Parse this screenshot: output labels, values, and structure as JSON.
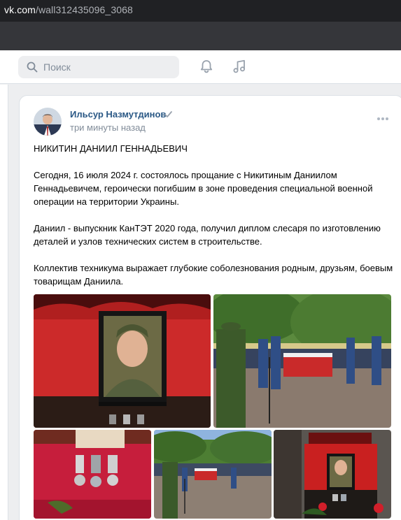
{
  "browser": {
    "url_host": "vk.com",
    "url_path": "/wall312435096_3068"
  },
  "header": {
    "search_placeholder": "Поиск",
    "icons": [
      "search-icon",
      "bell-icon",
      "music-icon"
    ]
  },
  "post": {
    "author": "Ильсур Назмутдинов",
    "time": "три минуты назад",
    "paragraphs": [
      "НИКИТИН ДАНИИЛ ГЕННАДЬЕВИЧ",
      "Сегодня, 16 июля 2024 г. состоялось прощание с Никитиным Даниилом Геннадьевичем, героически погибшим в зоне проведения специальной военной операции на территории Украины.",
      "Даниил - выпускник КанТЭТ 2020 года, получил диплом слесаря по изготовлению деталей и узлов технических систем в строительстве.",
      "Коллектив техникума выражает глубокие соболезнования родным, друзьям, боевым товарищам Даниила."
    ]
  },
  "colors": {
    "link": "#2a5885",
    "secondary": "#818c99",
    "verified": "#99a2ad",
    "page_bg": "#edeef0"
  }
}
